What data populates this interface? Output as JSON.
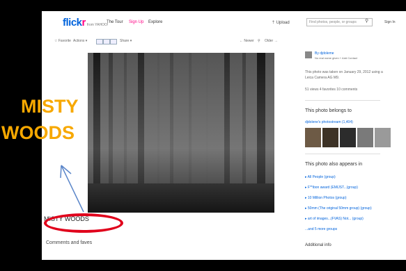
{
  "header": {
    "logo_main": "flick",
    "logo_r": "r",
    "logo_sub": "from YAHOO!",
    "nav": [
      "The Tour",
      "Sign Up",
      "Explore"
    ],
    "upload": "Upload",
    "search_placeholder": "Find photos, people, or groups",
    "signin": "Sign In"
  },
  "toolbar": {
    "favorite": "Favorite",
    "actions": "Actions",
    "share": "Share",
    "newer": "Newer",
    "older": "Older"
  },
  "photo": {
    "title": "MISTY WOODS",
    "comments_heading": "Comments and faves"
  },
  "sidebar": {
    "by": "By djdoleme",
    "byline_sub": "No real name given  + Add Contact",
    "taken_line1": "This photo was taken on January 29, 2012 using a",
    "taken_line2": "Leica Camera AG M9.",
    "stats": "51 views   4 favorites   10 comments",
    "belongs_heading": "This photo belongs to",
    "photostream": "djdolene's photostream (1,404)",
    "appears_heading": "This photo also appears in",
    "groups": [
      "All People (group)",
      "F**ibon award (EMIJST...(group)",
      "10 Million Photos (group)",
      "50mm (The original 50mm group) (group)",
      "art of images...(FVAS) Not... (group)"
    ],
    "more_groups": "...and 5 more groups",
    "additional": "Additional info"
  },
  "annotation": {
    "label_line1": "MISTY",
    "label_line2": "WOODS",
    "label_color": "#f7a800",
    "ellipse_color": "#e0001b",
    "arrow_color": "#5b86c9"
  }
}
